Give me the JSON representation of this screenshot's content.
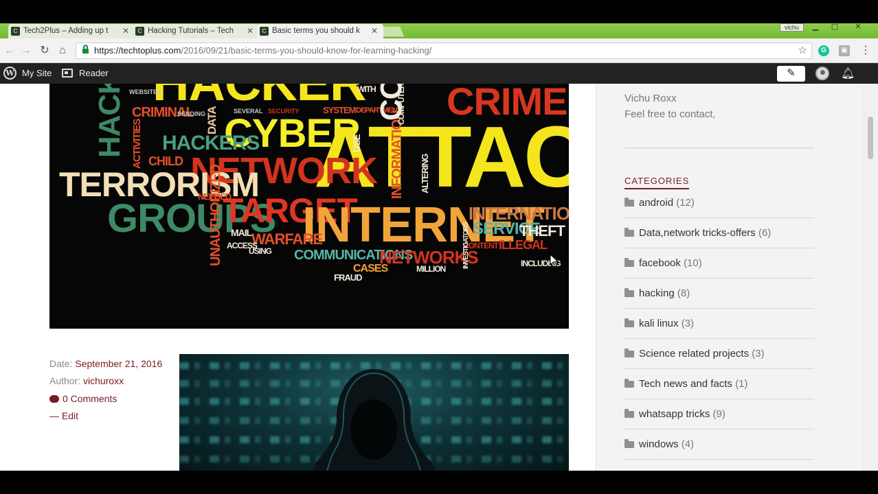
{
  "browser": {
    "tabs": [
      {
        "title": "Tech2Plus – Adding up t",
        "active": false
      },
      {
        "title": "Hacking Tutorials – Tech",
        "active": false
      },
      {
        "title": "Basic terms you should k",
        "active": true
      }
    ],
    "profile_name": "vichu",
    "url_scheme_host": "https://techtoplus.com",
    "url_path": "/2016/09/21/basic-terms-you-should-know-for-learning-hacking/",
    "accent_color": "#7fc241"
  },
  "wp_admin_bar": {
    "my_site_label": "My Site",
    "reader_label": "Reader"
  },
  "wordcloud": {
    "words": [
      "HACKER",
      "CRIME",
      "CYBER",
      "ATTACK",
      "NETWORK",
      "TERRORISM",
      "GROUPS",
      "TARGET",
      "INTERNET",
      "INTERNATIONAL",
      "SERVICE",
      "THEFT",
      "HACKING",
      "HACKERS",
      "CRIMINAL",
      "CHILD",
      "WEBSITES",
      "COMMUNICATIONS",
      "NETWORKS",
      "WARFARE",
      "UNAUTHORIZED",
      "INFORMATION",
      "ILLEGAL",
      "CONTENT",
      "MAIL",
      "CASES",
      "FRAUD",
      "MILLION",
      "INCLUDING",
      "NEEDED",
      "ACTIVITIES",
      "SYSTEM",
      "DEPARTMENT",
      "SEVERAL",
      "SECURITY",
      "INVESTIGATORS",
      "ALTERING",
      "DATA",
      "SENDING",
      "ACCESS",
      "USING",
      "COMPUTER",
      "USE",
      "WITH"
    ]
  },
  "post_meta": {
    "date_label": "Date:",
    "date_value": "September 21, 2016",
    "author_label": "Author:",
    "author_value": "vichuroxx",
    "comments": "0 Comments",
    "edit": "— Edit"
  },
  "sidebar": {
    "about_name": "Vichu Roxx",
    "about_text": "Feel free to contact,",
    "categories_title": "CATEGORIES",
    "categories": [
      {
        "name": "android",
        "count": "(12)"
      },
      {
        "name": "Data,network tricks-offers",
        "count": "(6)"
      },
      {
        "name": "facebook",
        "count": "(10)"
      },
      {
        "name": "hacking",
        "count": "(8)"
      },
      {
        "name": "kali linux",
        "count": "(3)"
      },
      {
        "name": "Science related projects",
        "count": "(3)"
      },
      {
        "name": "Tech news and facts",
        "count": "(1)"
      },
      {
        "name": "whatsapp tricks",
        "count": "(9)"
      },
      {
        "name": "windows",
        "count": "(4)"
      }
    ]
  },
  "icons": [
    "wordpress-logo-icon",
    "reader-icon",
    "write-icon",
    "avatar",
    "notifications-icon",
    "lock-icon",
    "star-icon",
    "back-icon",
    "forward-icon",
    "reload-icon",
    "home-icon",
    "folder-icon",
    "comment-icon",
    "mouse-cursor-icon"
  ]
}
